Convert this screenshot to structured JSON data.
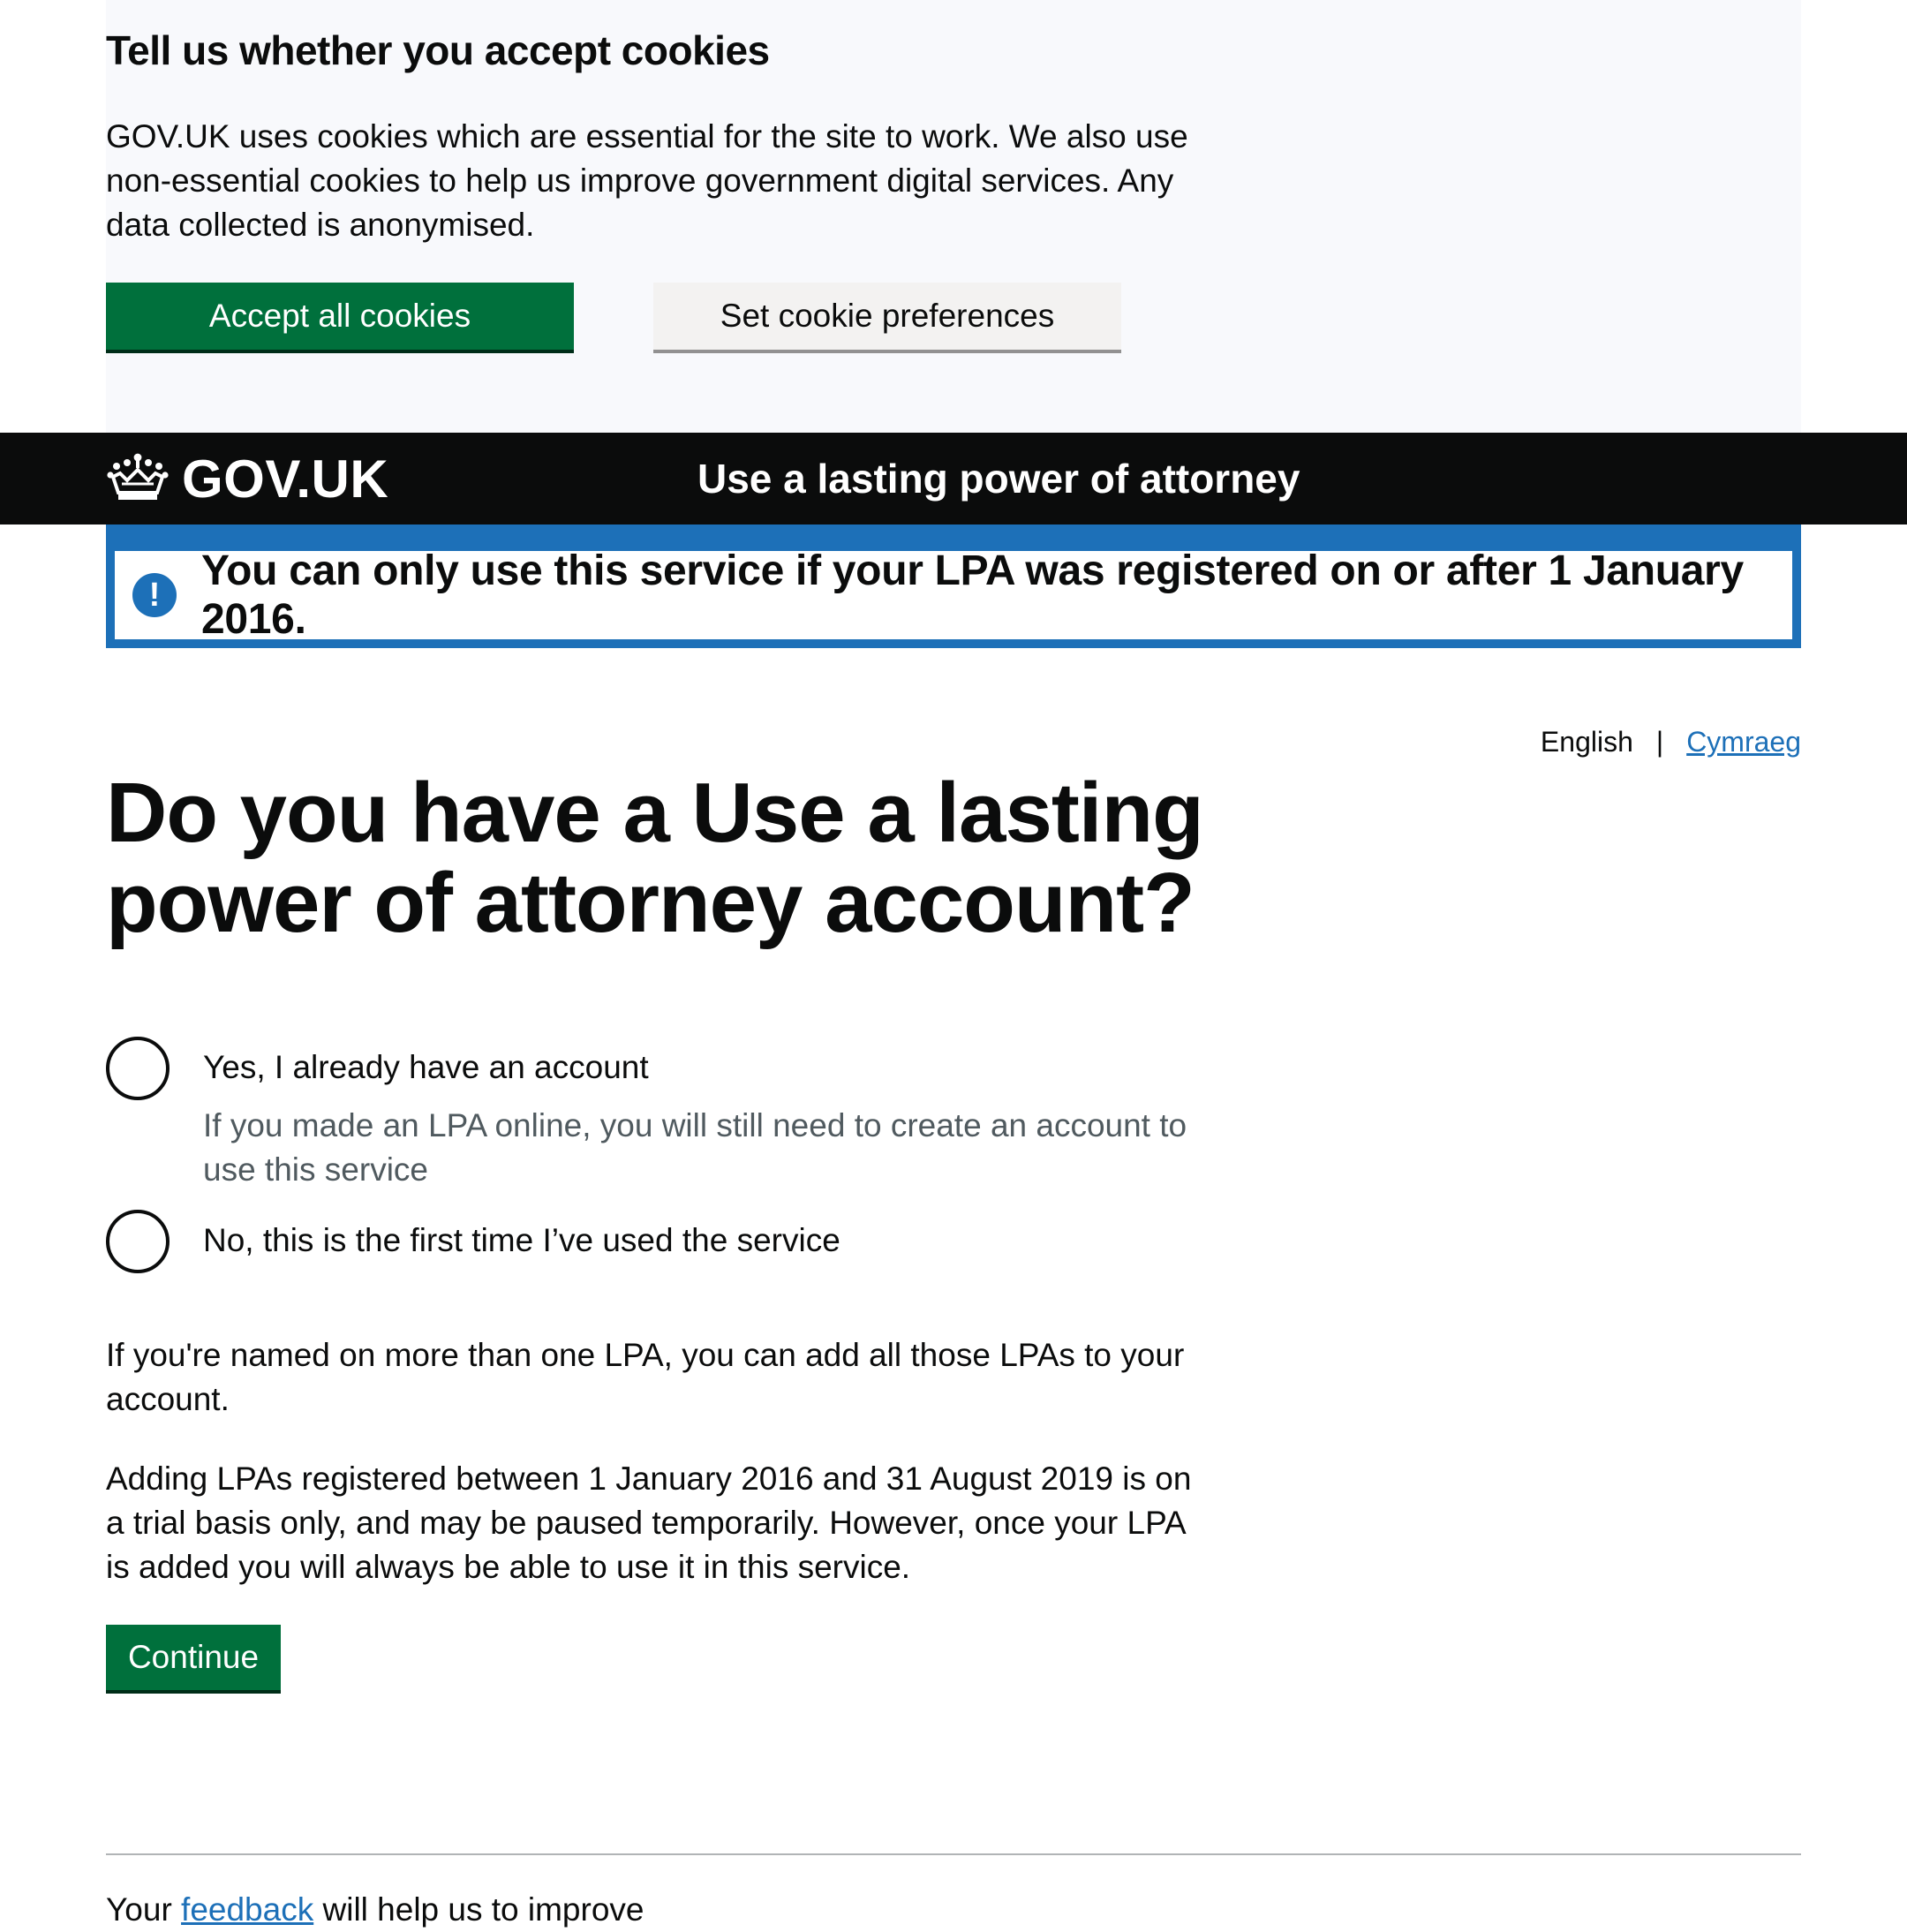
{
  "cookie_banner": {
    "title": "Tell us whether you accept cookies",
    "text": "GOV.UK uses cookies which are essential for the site to work. We also use non-essential cookies to help us improve government digital services. Any data collected is anonymised.",
    "accept_label": "Accept all cookies",
    "preferences_label": "Set cookie preferences"
  },
  "header": {
    "logo_icon": "crown-icon",
    "logo_text": "GOV.UK",
    "service_name": "Use a lasting power of attorney"
  },
  "notice": {
    "icon": "exclamation-icon",
    "text": "You can only use this service if your LPA was registered on or after 1 January 2016."
  },
  "language": {
    "current": "English",
    "separator": "|",
    "other": "Cymraeg"
  },
  "main": {
    "heading": "Do you have a Use a lasting power of attorney account?",
    "options": [
      {
        "label": "Yes, I already have an account",
        "hint": "If you made an LPA online, you will still need to create an account to use this service"
      },
      {
        "label": "No, this is the first time I’ve used the service"
      }
    ],
    "paragraph_1": "If you're named on more than one LPA, you can add all those LPAs to your account.",
    "paragraph_2": "Adding LPAs registered between 1 January 2016 and 31 August 2019 is on a trial basis only, and may be paused temporarily. However, once your LPA is added you will always be able to use it in this service.",
    "continue_label": "Continue"
  },
  "footer": {
    "feedback_prefix": "Your ",
    "feedback_link": "feedback",
    "feedback_suffix": " will help us to improve"
  },
  "colors": {
    "brand_green": "#00703c",
    "header_black": "#0b0c0c",
    "notice_blue": "#1d70b8",
    "link_blue": "#1d70b8",
    "hint_grey": "#505a5f"
  }
}
